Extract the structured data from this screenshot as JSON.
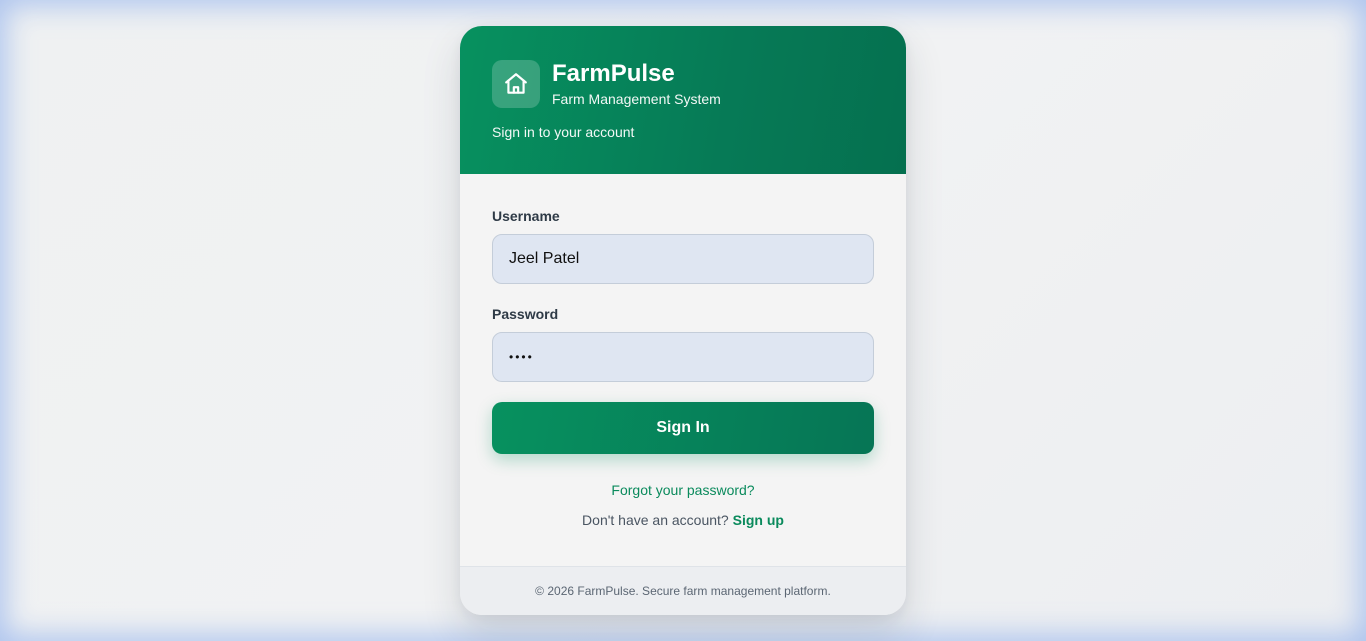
{
  "brand": {
    "name": "FarmPulse",
    "subtitle": "Farm Management System",
    "tagline": "Sign in to your account",
    "logo_icon": "home-icon"
  },
  "form": {
    "username_label": "Username",
    "username_value": "Jeel Patel",
    "password_label": "Password",
    "password_masked": "••••",
    "submit_label": "Sign In",
    "forgot_label": "Forgot your password?",
    "signup_prompt": "Don't have an account?",
    "signup_label": "Sign up"
  },
  "footer": {
    "text": "© 2026 FarmPulse. Secure farm management platform."
  },
  "colors": {
    "brand_green": "#07915f",
    "brand_green_dark": "#05704f",
    "link_green": "#0a8a5c",
    "input_bg": "#dfe6f2"
  }
}
